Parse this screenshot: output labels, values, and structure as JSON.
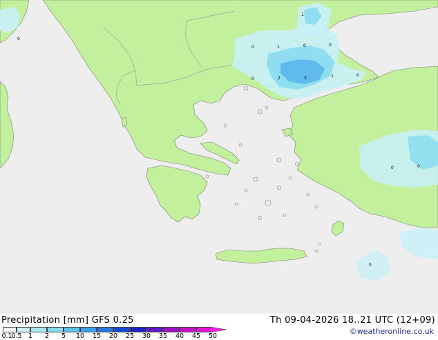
{
  "header": {
    "product": "Precipitation [mm]",
    "model": "GFS 0.25",
    "valid_time": "Th 09-04-2026 18..21 UTC (12+09)",
    "credit": "©weatheronline.co.uk"
  },
  "legend": {
    "ticks": [
      "0.1",
      "0.5",
      "1",
      "2",
      "5",
      "10",
      "15",
      "20",
      "25",
      "30",
      "35",
      "40",
      "45",
      "50"
    ],
    "colors": [
      "#f5fbff",
      "#c8f0f8",
      "#a8e8f4",
      "#88dcf0",
      "#5cc4ec",
      "#3ca0e8",
      "#2874e0",
      "#1c48d8",
      "#2020c8",
      "#6018c8",
      "#9c10c8",
      "#c810c8",
      "#e810d8",
      "#f020e0"
    ]
  },
  "colors": {
    "sea": "#eeeeee",
    "land": "#c3f09c",
    "coast": "#7a7a7a",
    "border": "#a0a0a0",
    "precip_light": "#c8f0f8",
    "precip_mid": "#88dcf0",
    "precip_heavy": "#5cb8ea"
  },
  "map_labels": [
    "1",
    "0",
    "1",
    "0",
    "0",
    "0",
    "2",
    "3",
    "1",
    "0",
    "0",
    "0",
    "0",
    "0"
  ]
}
